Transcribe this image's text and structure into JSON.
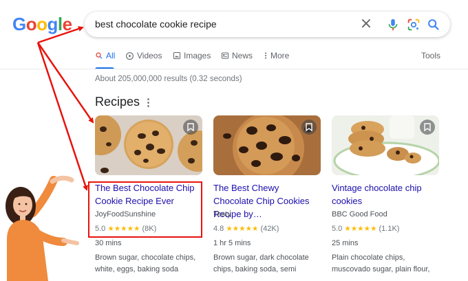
{
  "logo": {
    "letters": [
      "G",
      "o",
      "o",
      "g",
      "l",
      "e"
    ],
    "colors": [
      "#4285f4",
      "#ea4335",
      "#fbbc05",
      "#4285f4",
      "#34a853",
      "#ea4335"
    ]
  },
  "search": {
    "query": "best chocolate cookie recipe"
  },
  "tabs": [
    {
      "label": "All",
      "icon": "search-icon",
      "active": true
    },
    {
      "label": "Videos",
      "icon": "play-icon"
    },
    {
      "label": "Images",
      "icon": "image-icon"
    },
    {
      "label": "News",
      "icon": "news-icon"
    },
    {
      "label": "More",
      "icon": "more-vert-icon"
    }
  ],
  "tools_label": "Tools",
  "result_stats": "About 205,000,000 results (0.32 seconds)",
  "recipes": {
    "title": "Recipes",
    "cards": [
      {
        "title": "The Best Chocolate Chip Cookie Recipe Ever",
        "source": "JoyFoodSunshine",
        "rating": "5.0",
        "reviews": "(8K)",
        "stars": "★★★★★",
        "time": "30 mins",
        "ingredients": "Brown sugar, chocolate chips, white, eggs, baking soda"
      },
      {
        "title": "The Best Chewy Chocolate Chip Cookies Recipe by…",
        "source": "Tasty",
        "rating": "4.8",
        "reviews": "(42K)",
        "stars": "★★★★★",
        "time": "1 hr 5 mins",
        "ingredients": "Brown sugar, dark chocolate chips, baking soda, semi"
      },
      {
        "title": "Vintage chocolate chip cookies",
        "source": "BBC Good Food",
        "rating": "5.0",
        "reviews": "(1.1K)",
        "stars": "★★★★★",
        "time": "25 mins",
        "ingredients": "Plain chocolate chips, muscovado sugar, plain flour,"
      }
    ]
  },
  "colors": {
    "link": "#1a0dab",
    "accent": "#1a73e8",
    "annotation": "#e8120c",
    "star": "#fbbc04"
  }
}
